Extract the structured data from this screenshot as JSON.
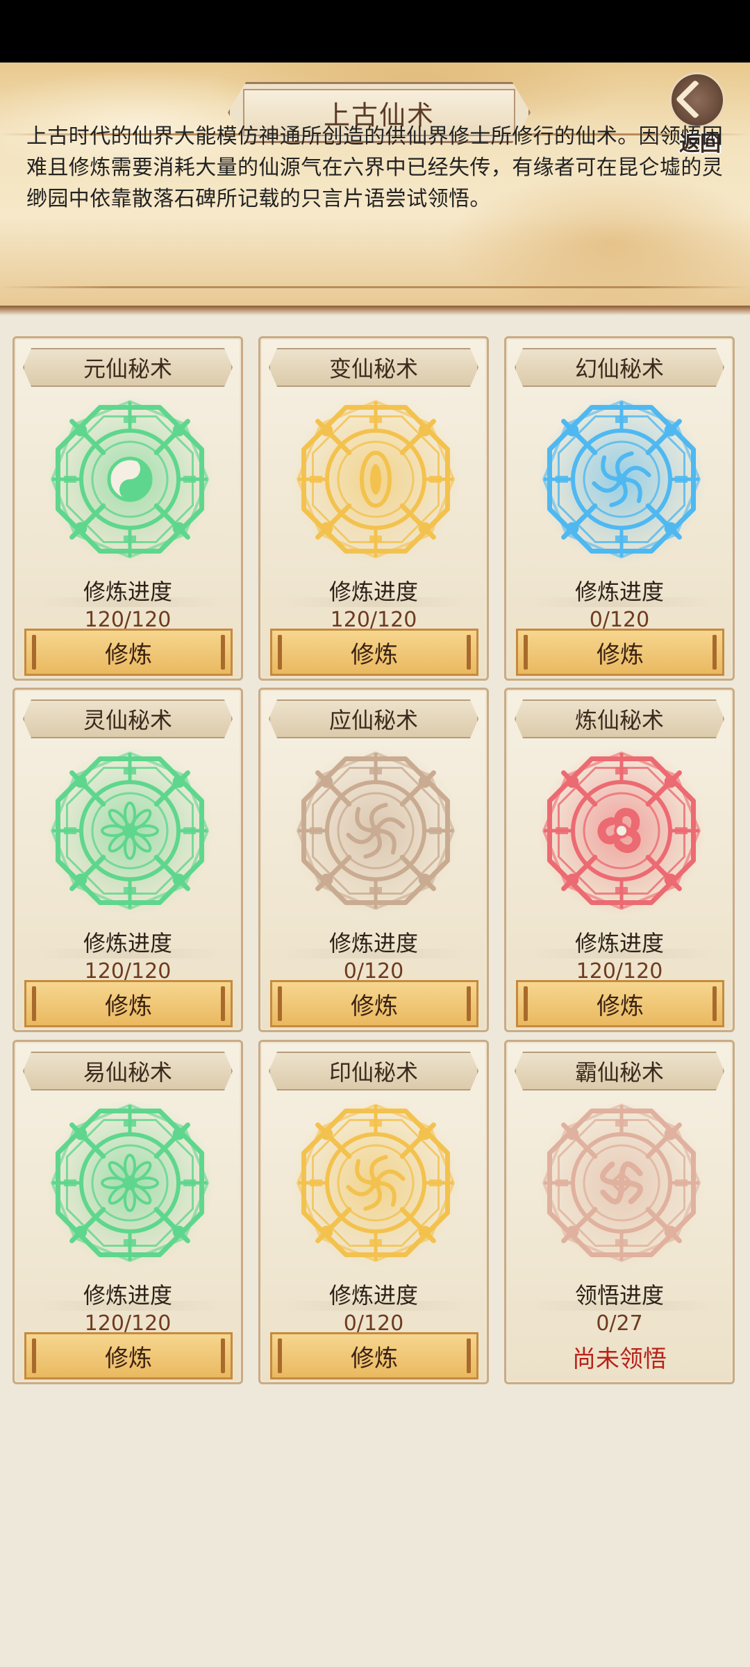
{
  "header": {
    "title": "上古仙术",
    "back_label": "返回",
    "description": "上古时代的仙界大能模仿神通所创造的供仙界修士所修行的仙术。因领悟困难且修炼需要消耗大量的仙源气在六界中已经失传，有缘者可在昆仑墟的灵缈园中依靠散落石碑所记载的只言片语尝试领悟。"
  },
  "cards": [
    {
      "name": "元仙秘术",
      "progress_label": "修炼进度",
      "progress": "120/120",
      "button": "修炼",
      "color": "#5fd68d",
      "pattern": "yinyang"
    },
    {
      "name": "变仙秘术",
      "progress_label": "修炼进度",
      "progress": "120/120",
      "button": "修炼",
      "color": "#f3c24e",
      "pattern": "eye"
    },
    {
      "name": "幻仙秘术",
      "progress_label": "修炼进度",
      "progress": "0/120",
      "button": "修炼",
      "color": "#4fb8f0",
      "pattern": "vortex"
    },
    {
      "name": "灵仙秘术",
      "progress_label": "修炼进度",
      "progress": "120/120",
      "button": "修炼",
      "color": "#5fd68d",
      "pattern": "flower"
    },
    {
      "name": "应仙秘术",
      "progress_label": "修炼进度",
      "progress": "0/120",
      "button": "修炼",
      "color": "#c9ab92",
      "pattern": "spiral"
    },
    {
      "name": "炼仙秘术",
      "progress_label": "修炼进度",
      "progress": "120/120",
      "button": "修炼",
      "color": "#ec6a72",
      "pattern": "triskelion"
    },
    {
      "name": "易仙秘术",
      "progress_label": "修炼进度",
      "progress": "120/120",
      "button": "修炼",
      "color": "#5fd68d",
      "pattern": "flower"
    },
    {
      "name": "印仙秘术",
      "progress_label": "修炼进度",
      "progress": "0/120",
      "button": "修炼",
      "color": "#f3c24e",
      "pattern": "spiral"
    },
    {
      "name": "霸仙秘术",
      "progress_label": "领悟进度",
      "progress": "0/27",
      "button": "",
      "status": "尚未领悟",
      "color": "#dfb19e",
      "pattern": "knot"
    }
  ]
}
